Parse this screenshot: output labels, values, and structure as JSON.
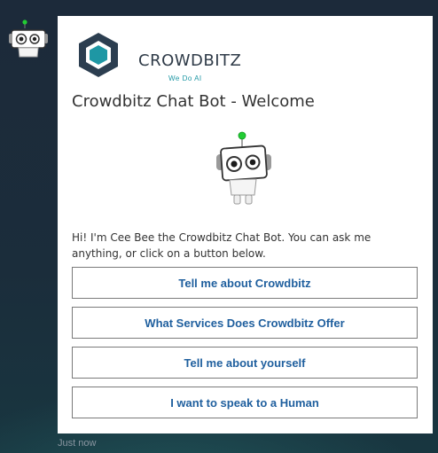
{
  "brand": {
    "name": "CROWDBITZ",
    "tagline": "We Do AI"
  },
  "card": {
    "title": "Crowdbitz Chat Bot - Welcome",
    "intro": "Hi! I'm Cee Bee the Crowdbitz Chat Bot. You can ask me anything, or click on a button below."
  },
  "actions": [
    {
      "label": "Tell me about Crowdbitz"
    },
    {
      "label": "What Services Does Crowdbitz Offer"
    },
    {
      "label": "Tell me about yourself"
    },
    {
      "label": "I want to speak to a Human"
    }
  ],
  "message": {
    "timestamp": "Just now"
  },
  "colors": {
    "button_text": "#1f5f9e",
    "brand_teal": "#1e97a4",
    "status_online": "#22cc33"
  }
}
